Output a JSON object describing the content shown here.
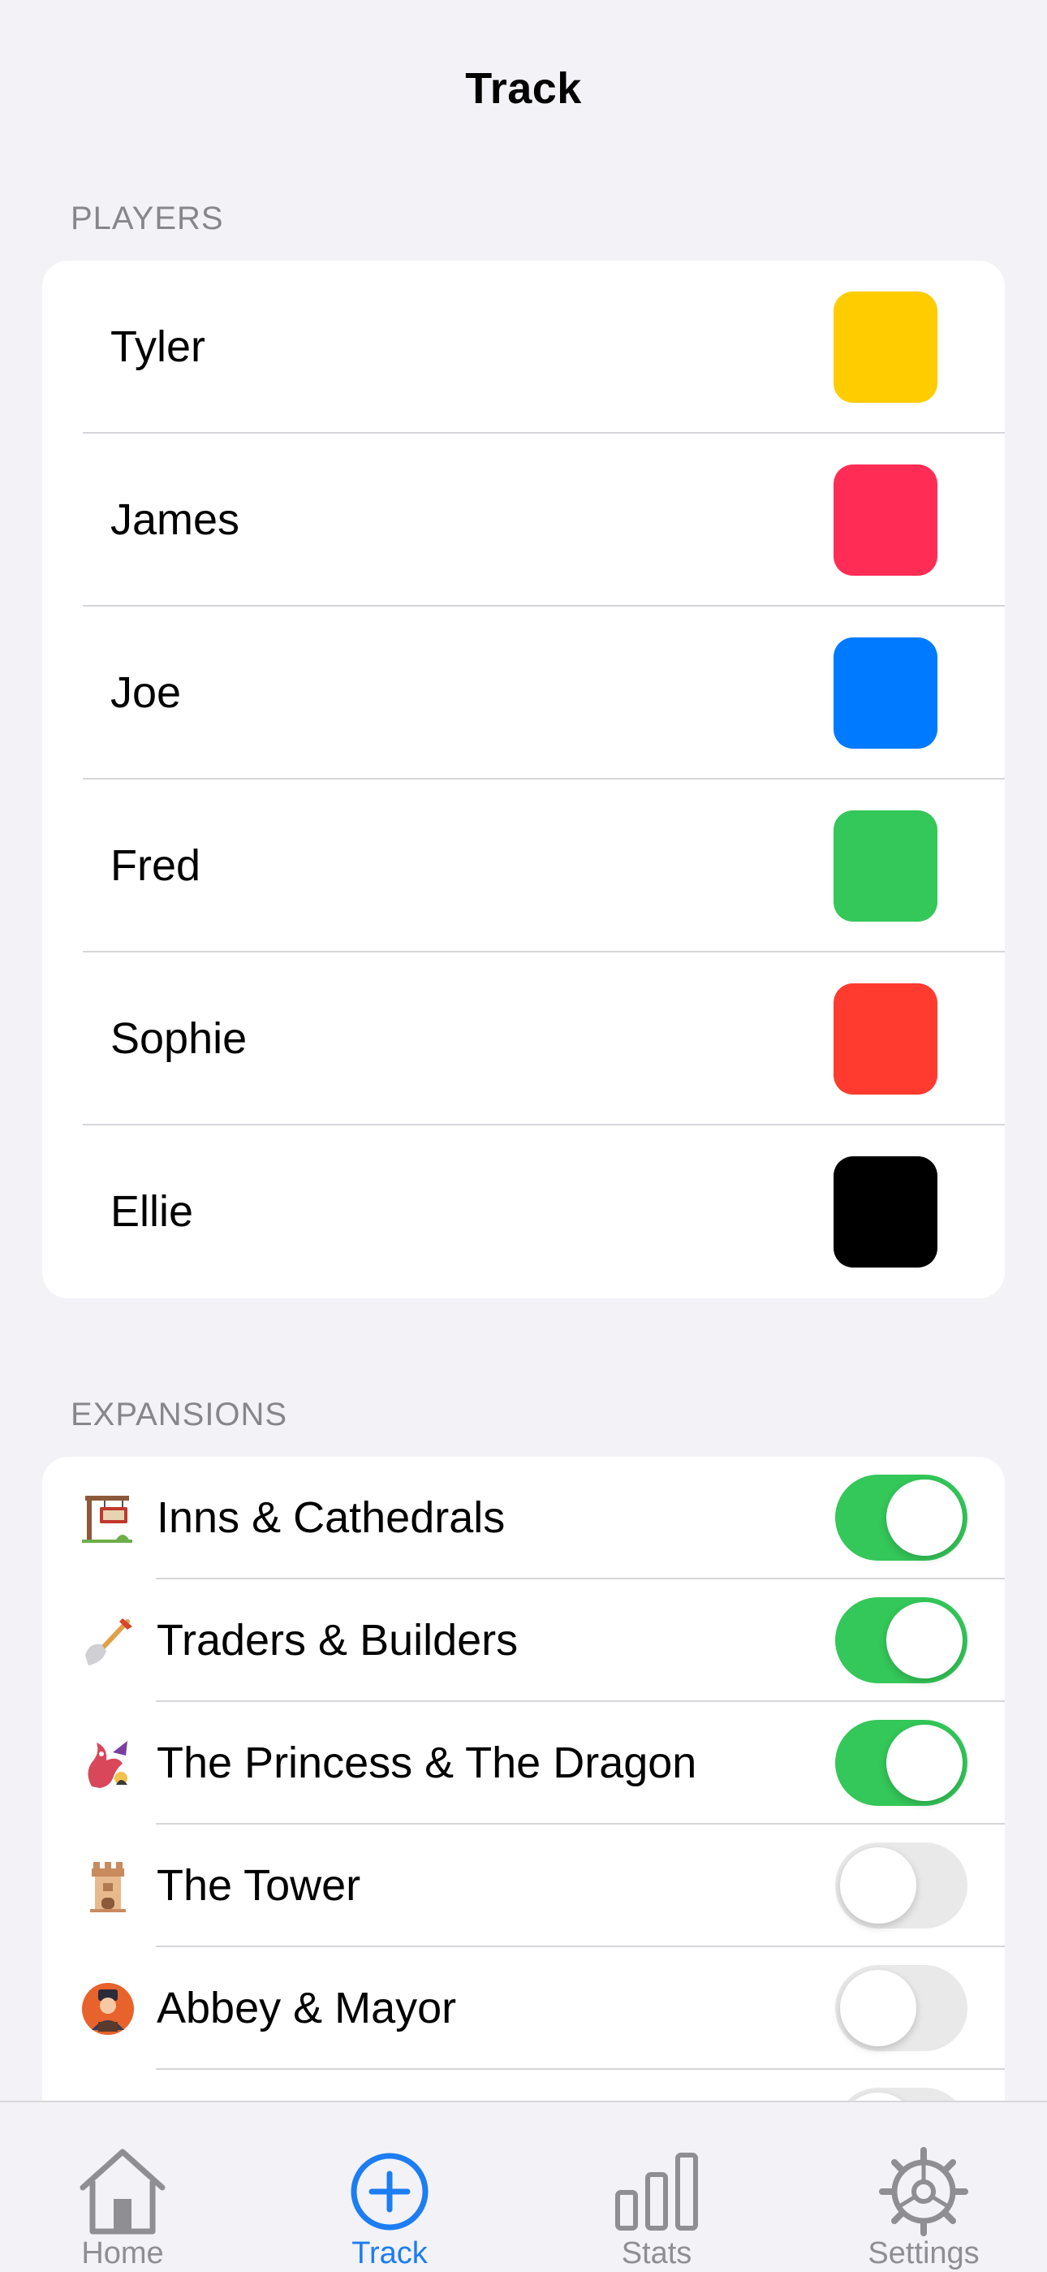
{
  "nav": {
    "title": "Track"
  },
  "players_section": {
    "header": "PLAYERS",
    "players": [
      {
        "name": "Tyler",
        "color": "#ffcc00"
      },
      {
        "name": "James",
        "color": "#ff2d55"
      },
      {
        "name": "Joe",
        "color": "#007aff"
      },
      {
        "name": "Fred",
        "color": "#34c759"
      },
      {
        "name": "Sophie",
        "color": "#ff3b30"
      },
      {
        "name": "Ellie",
        "color": "#000000"
      }
    ]
  },
  "expansions_section": {
    "header": "EXPANSIONS",
    "items": [
      {
        "label": "Inns & Cathedrals",
        "icon": "inn-sign-icon",
        "enabled": true
      },
      {
        "label": "Traders & Builders",
        "icon": "shovel-icon",
        "enabled": true
      },
      {
        "label": "The Princess & The Dragon",
        "icon": "dragon-icon",
        "enabled": true
      },
      {
        "label": "The Tower",
        "icon": "tower-icon",
        "enabled": false
      },
      {
        "label": "Abbey & Mayor",
        "icon": "mayor-icon",
        "enabled": false
      }
    ]
  },
  "tabbar": {
    "tabs": [
      {
        "label": "Home",
        "icon": "house-icon",
        "active": false
      },
      {
        "label": "Track",
        "icon": "plus-circle-icon",
        "active": true
      },
      {
        "label": "Stats",
        "icon": "bar-chart-icon",
        "active": false
      },
      {
        "label": "Settings",
        "icon": "gear-icon",
        "active": false
      }
    ]
  },
  "colors": {
    "background": "#f2f2f7",
    "accent": "#1d7df2",
    "toggle_on": "#34c759",
    "toggle_off": "#e9e9ea"
  }
}
